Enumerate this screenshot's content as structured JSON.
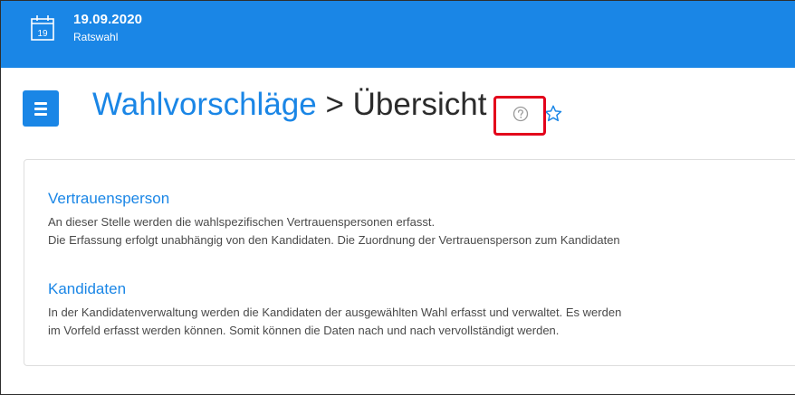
{
  "header": {
    "date": "19.09.2020",
    "subtitle": "Ratswahl",
    "calendar_day": "19"
  },
  "page": {
    "breadcrumb": "Wahlvorschläge",
    "separator": ">",
    "title": "Übersicht"
  },
  "sections": [
    {
      "title": "Vertrauensperson",
      "lines": [
        "An dieser Stelle werden die wahlspezifischen Vertrauenspersonen erfasst.",
        "Die Erfassung erfolgt unabhängig von den Kandidaten. Die Zuordnung der Vertrauensperson zum Kandidaten"
      ]
    },
    {
      "title": "Kandidaten",
      "lines": [
        "In der Kandidatenverwaltung werden die Kandidaten der ausgewählten Wahl erfasst und verwaltet. Es werden",
        "im Vorfeld erfasst werden können. Somit können die Daten nach und nach vervollständigt werden."
      ]
    }
  ],
  "colors": {
    "accent": "#1a86e6",
    "highlight": "#e3001b"
  },
  "icons": [
    "calendar-icon",
    "hamburger-menu-icon",
    "help-icon",
    "star-icon"
  ]
}
